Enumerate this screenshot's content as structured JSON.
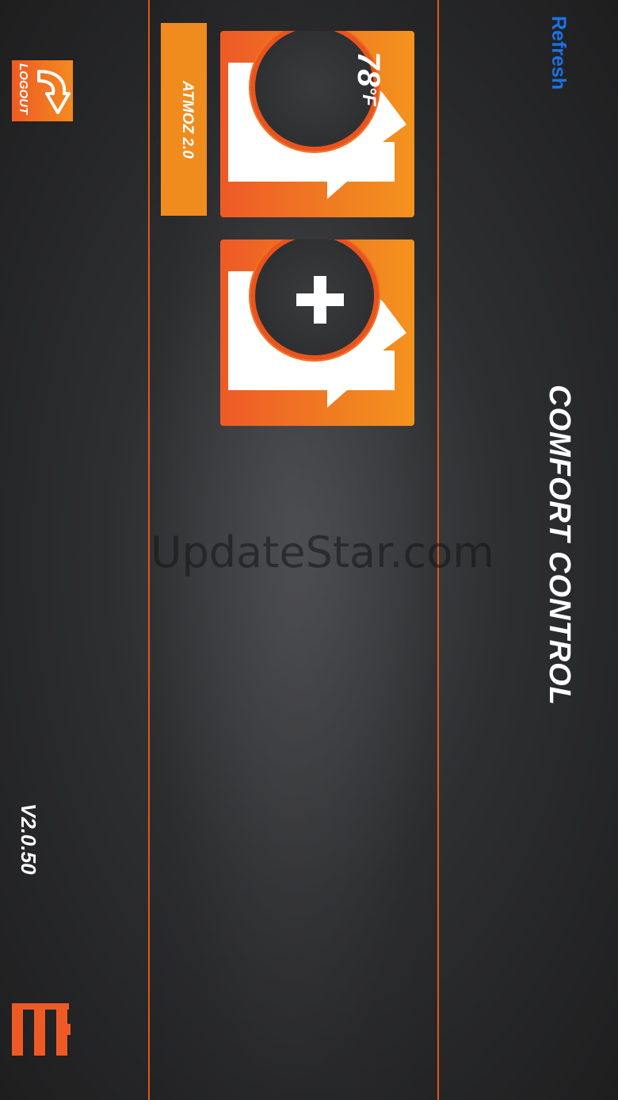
{
  "header": {
    "refresh_label": "Refresh",
    "title": "COMFORT CONTROL"
  },
  "sidebar": {
    "logout_label": "LOGOUT",
    "version": "V2.0.50",
    "menu_icon": "menu-icon"
  },
  "devices": [
    {
      "name": "ATMOZ 2.0",
      "temperature": "78",
      "unit": "°F"
    }
  ],
  "add_device_icon": "plus-icon",
  "watermark": "UpdateStar.com",
  "colors": {
    "accent": "#f08c1e",
    "accent_dark": "#ee5a26",
    "link": "#1a73e8",
    "background": "#2e2f31"
  }
}
